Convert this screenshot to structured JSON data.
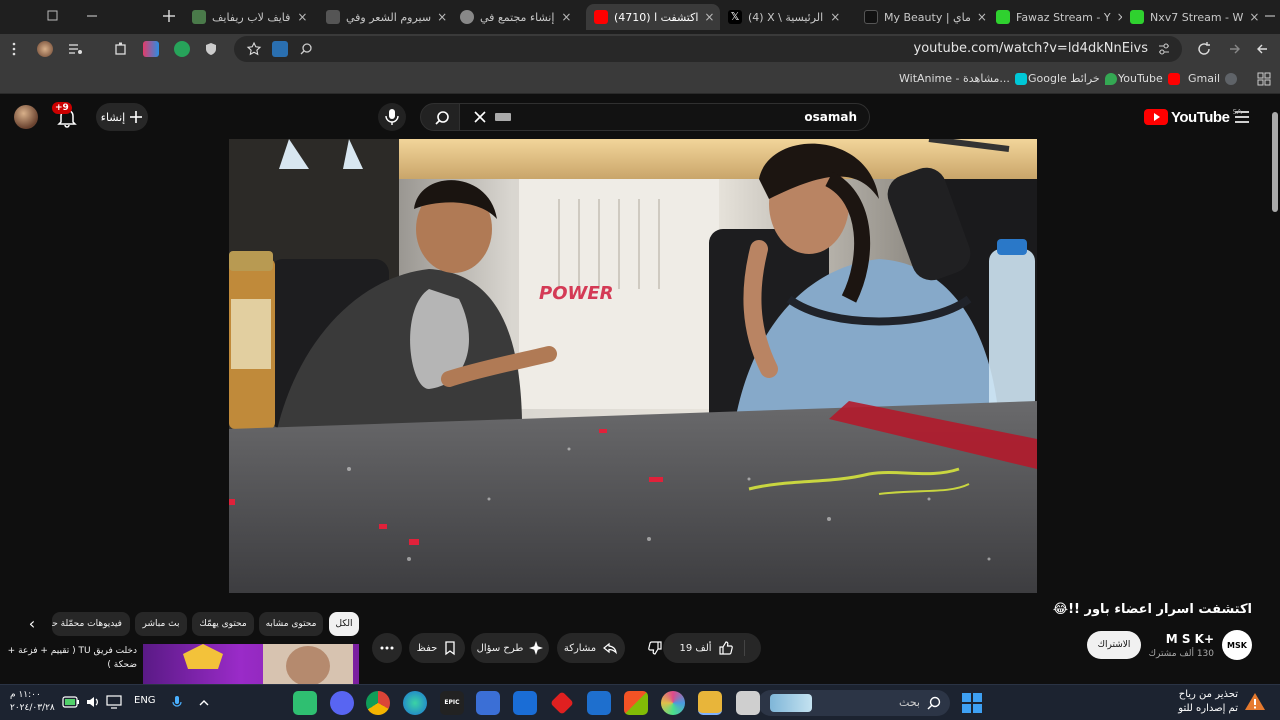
{
  "browser": {
    "tabs": [
      {
        "title": "Nxv7 Stream - W",
        "color": "#2fd12f"
      },
      {
        "title": "Fawaz Stream - Y",
        "color": "#2fd12f"
      },
      {
        "title": "My Beauty | ماي",
        "color": "#111111"
      },
      {
        "title": "(4) X \\ الرئيسية",
        "color": "#000000"
      },
      {
        "title": "(4710) اكتشفت ا",
        "color": "#ff0000"
      },
      {
        "title": "إنشاء مجتمع في",
        "color": "#888888"
      },
      {
        "title": "سيروم الشعر وفي",
        "color": "#555555"
      },
      {
        "title": "فايف لاب ريفايف",
        "color": "#4a7a4a"
      }
    ],
    "url": "youtube.com/watch?v=ld4dkNnEivs",
    "bookmarks": [
      {
        "label": "Gmail",
        "color": "#ea4335"
      },
      {
        "label": "YouTube",
        "color": "#ff0000"
      },
      {
        "label": "Google خرائط",
        "color": "#34a853"
      },
      {
        "label": "WitAnime - مشاهدة...",
        "color": "#00c8d7"
      }
    ]
  },
  "youtube": {
    "logo": "YouTube",
    "region": "SA",
    "search_value": "osamah",
    "create_label": "إنشاء",
    "notifications": "+9",
    "video_overlay_text": "POWER",
    "video_title": "اكتشفت اسرار اعضاء باور !!😂",
    "channel_name": "M S K+",
    "channel_avatar_text": "MSK",
    "subscribers": "130 ألف مشترك",
    "subscribe_label": "الاشتراك",
    "like_count": "19 ألف",
    "share_label": "مشاركة",
    "ask_label": "طرح سؤال",
    "save_label": "حفظ",
    "chips": [
      "الكل",
      "محتوى مشابه",
      "محتوى يهمّك",
      "بث مباشر",
      "فيديوهات محمّلة حد"
    ],
    "related_title": "دخلت فريق TU ( تقييم + فزعة + ضحكة )"
  },
  "taskbar": {
    "weather_line1": "تحذير من رياح",
    "weather_line2": "تم إصداره للتو",
    "search_placeholder": "بحث",
    "language": "ENG",
    "time": "١١:٠٠ م",
    "date": "٢٠٢٤/٠٣/٢٨"
  }
}
